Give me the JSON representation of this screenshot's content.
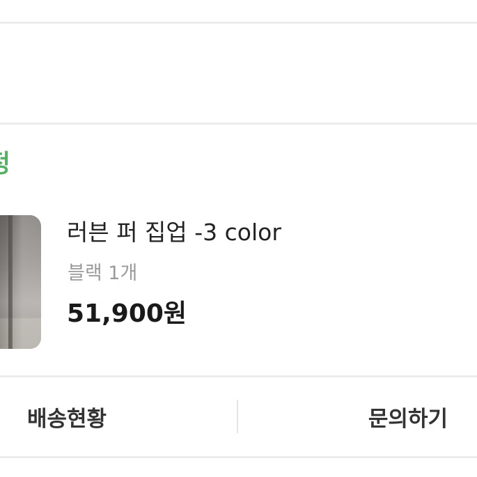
{
  "order": {
    "status_text": "정"
  },
  "product": {
    "name": "러븐 퍼 집업 -3 color",
    "option": "블랙 1개",
    "price": "51,900원",
    "thumbnail_icon": "product-photo"
  },
  "actions": {
    "shipping_status_label": "배송현황",
    "inquiry_label": "문의하기"
  },
  "colors": {
    "status_green": "#58b067",
    "text_primary": "#222222",
    "text_secondary": "#9a9a9a",
    "divider": "#ececec"
  }
}
